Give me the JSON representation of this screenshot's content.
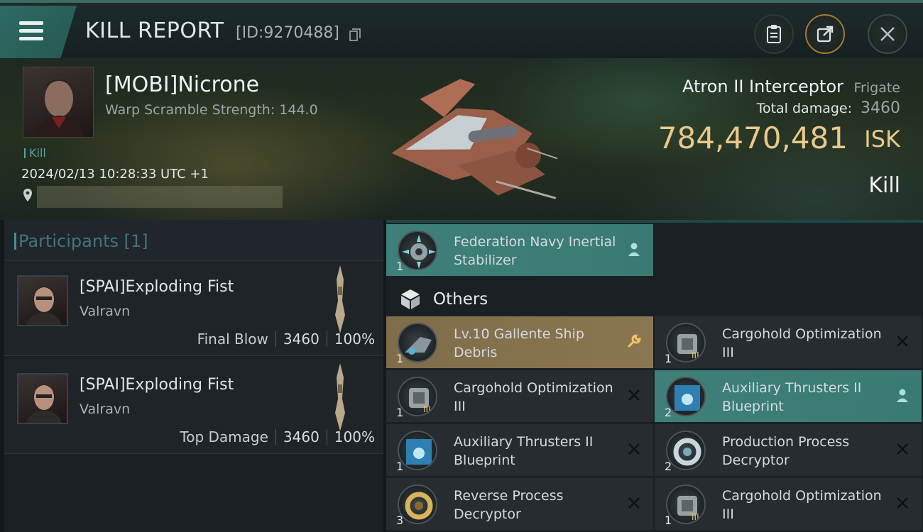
{
  "header": {
    "title": "KILL REPORT",
    "id_text": "[ID:9270488]"
  },
  "victim": {
    "name": "[MOBI]Nicrone",
    "warp_scramble": "Warp Scramble Strength: 144.0",
    "tag": "Kill",
    "datetime": "2024/02/13 10:28:33 UTC +1",
    "ship_name": "Atron II Interceptor",
    "ship_class": "Frigate",
    "total_damage_label": "Total damage:",
    "total_damage": "3460",
    "isk_value": "784,470,481",
    "isk_unit": "ISK",
    "result": "Kill"
  },
  "participants": {
    "title": "Participants [1]",
    "rows": [
      {
        "name": "[SPAI]Exploding Fist",
        "ship": "Valravn",
        "role": "Final Blow",
        "damage": "3460",
        "percent": "100%"
      },
      {
        "name": "[SPAI]Exploding Fist",
        "ship": "Valravn",
        "role": "Top Damage",
        "damage": "3460",
        "percent": "100%"
      }
    ]
  },
  "items": {
    "top": {
      "name": "Federation Navy Inertial Stabilizer",
      "qty": "1"
    },
    "others_label": "Others",
    "list": [
      {
        "name": "Lv.10 Gallente Ship Debris",
        "qty": "1"
      },
      {
        "name": "Cargohold Optimization III",
        "qty": "1"
      },
      {
        "name": "Cargohold Optimization III",
        "qty": "1"
      },
      {
        "name": "Auxiliary Thrusters II Blueprint",
        "qty": "2"
      },
      {
        "name": "Auxiliary Thrusters II Blueprint",
        "qty": "1"
      },
      {
        "name": "Production Process Decryptor",
        "qty": "2"
      },
      {
        "name": "Reverse Process Decryptor",
        "qty": "3"
      },
      {
        "name": "Cargohold Optimization III",
        "qty": "1"
      }
    ]
  },
  "colors": {
    "accent_teal": "#3e8079",
    "gold": "#e9c98a",
    "gold_item": "#8a7650"
  }
}
